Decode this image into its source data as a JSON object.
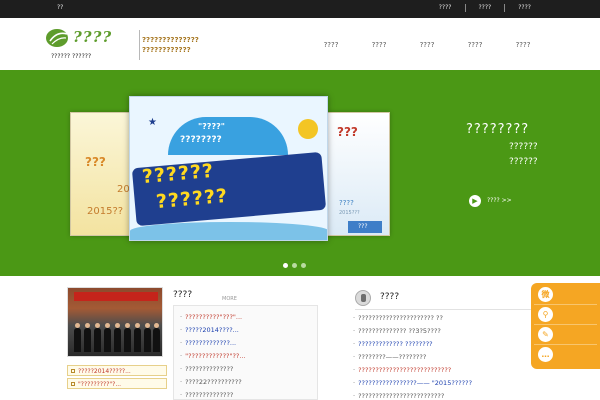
{
  "topbar": {
    "left": "??",
    "links": [
      "????",
      "????",
      "????"
    ]
  },
  "header": {
    "logo_text": "????",
    "logo_slogan": "??????   ??????",
    "tagline": [
      "??????????????",
      "????????????"
    ],
    "nav": [
      "????",
      "????",
      "????",
      "????",
      "????"
    ]
  },
  "banner": {
    "left_slide": {
      "line1": "???",
      "line2": "201",
      "line3": "2015??"
    },
    "right_slide": {
      "line1": "???",
      "line2": "????",
      "line3": "2015???",
      "button": "???"
    },
    "main_slide": {
      "arch_line1": "\"????\"",
      "arch_line2": "????????",
      "big_line1": "??????",
      "big_line2": "??????"
    },
    "title": "????????",
    "sub1": "??????",
    "sub2": "??????",
    "enter_label": "???? >>",
    "dots_count": 3,
    "active_dot": 0
  },
  "left_list": [
    "?????2014?????...",
    "\"?????????\"?..."
  ],
  "news": {
    "heading": "????",
    "more": "MORE",
    "items": [
      {
        "text": "??????????\"???\"...",
        "color": "red"
      },
      {
        "text": "?????2014????...",
        "color": "blue"
      },
      {
        "text": "?????????????...",
        "color": "blue"
      },
      {
        "text": "\"????????????\"??...",
        "color": "red"
      },
      {
        "text": "??????????????",
        "color": "gray"
      },
      {
        "text": "????22??????????",
        "color": "gray"
      },
      {
        "text": "??????????????",
        "color": "gray"
      },
      {
        "text": "??????????????",
        "color": "gray"
      }
    ]
  },
  "hot": {
    "heading": "????",
    "items": [
      {
        "text": "?????????????????????? ??",
        "color": "gray"
      },
      {
        "text": "?????????????? ??3?5????",
        "color": "gray"
      },
      {
        "text": "????????????? ????????",
        "color": "blue"
      },
      {
        "text": "????????——????????",
        "color": "gray"
      },
      {
        "text": "???????????????????????????",
        "color": "red"
      },
      {
        "text": "?????????????????—— \"2015??????",
        "color": "blue"
      },
      {
        "text": "?????????????????????????",
        "color": "gray"
      }
    ]
  },
  "side_panel": {
    "icons": [
      "weibo-icon",
      "search-icon",
      "edit-icon",
      "chat-icon"
    ]
  }
}
